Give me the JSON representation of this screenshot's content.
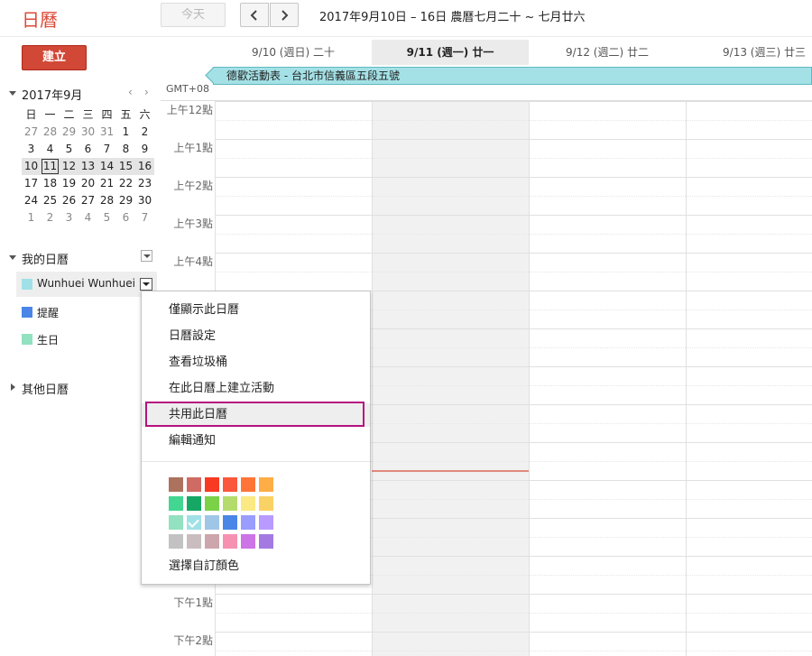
{
  "header": {
    "logo": "日曆",
    "today_button": "今天",
    "date_range": "2017年9月10日 – 16日 農曆七月二十 ~ 七月廿六"
  },
  "sidebar": {
    "create_button": "建立",
    "mini_calendar": {
      "title": "2017年9月",
      "prev": "‹",
      "next": "›",
      "weekdays": [
        "日",
        "一",
        "二",
        "三",
        "四",
        "五",
        "六"
      ],
      "weeks": [
        [
          "27",
          "28",
          "29",
          "30",
          "31",
          "1",
          "2"
        ],
        [
          "3",
          "4",
          "5",
          "6",
          "7",
          "8",
          "9"
        ],
        [
          "10",
          "11",
          "12",
          "13",
          "14",
          "15",
          "16"
        ],
        [
          "17",
          "18",
          "19",
          "20",
          "21",
          "22",
          "23"
        ],
        [
          "24",
          "25",
          "26",
          "27",
          "28",
          "29",
          "30"
        ],
        [
          "1",
          "2",
          "3",
          "4",
          "5",
          "6",
          "7"
        ]
      ],
      "today": "11"
    },
    "my_calendars": {
      "label": "我的日曆",
      "items": [
        {
          "name": "Wunhuei Wunhuei",
          "color": "#9fe1e7"
        },
        {
          "name": "提醒",
          "color": "#4986e7"
        },
        {
          "name": "生日",
          "color": "#92e1c0"
        }
      ]
    },
    "other_calendars": {
      "label": "其他日曆"
    }
  },
  "grid": {
    "gmt": "GMT+08",
    "days": [
      {
        "label": "9/10 (週日) 二十"
      },
      {
        "label": "9/11 (週一) 廿一"
      },
      {
        "label": "9/12 (週二) 廿二"
      },
      {
        "label": "9/13 (週三) 廿三"
      }
    ],
    "allday_event": "德歡活動表 - 台北市信義區五段五號",
    "hours": [
      "上午12點",
      "上午1點",
      "上午2點",
      "上午3點",
      "上午4點",
      "",
      "",
      "",
      "",
      "",
      "",
      "",
      "下午1點",
      "下午2點"
    ]
  },
  "popup_menu": {
    "items": [
      "僅顯示此日曆",
      "日曆設定",
      "查看垃圾桶",
      "在此日曆上建立活動",
      "共用此日曆",
      "編輯通知"
    ],
    "custom_color": "選擇自訂顏色",
    "swatch_rows": [
      [
        "#ac725e",
        "#d06b64",
        "#f83a22",
        "#fa573c",
        "#ff7537",
        "#ffad46"
      ],
      [
        "#42d692",
        "#16a765",
        "#7bd148",
        "#b3dc6c",
        "#fbe983",
        "#fad165"
      ],
      [
        "#92e1c0",
        "#9fe1e7",
        "#9fc6e7",
        "#4986e7",
        "#9a9cff",
        "#b99aff"
      ],
      [
        "#c2c2c2",
        "#cabdbf",
        "#cca6ac",
        "#f691b2",
        "#cd74e6",
        "#a47ae2"
      ]
    ],
    "checked_color": "#9fe1e7"
  }
}
